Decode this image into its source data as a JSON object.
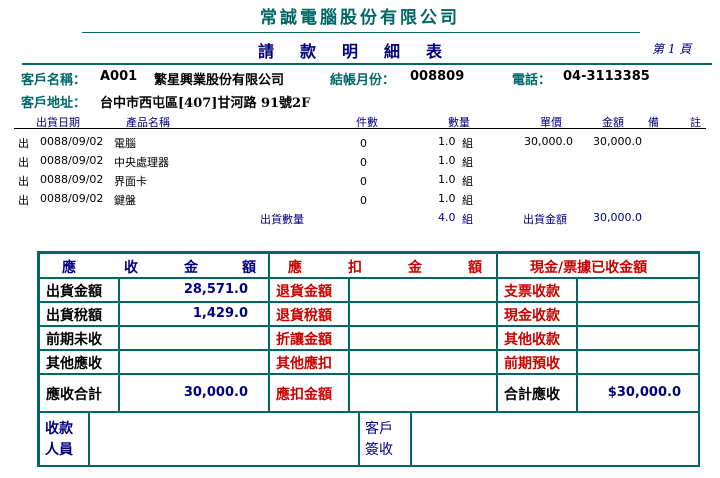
{
  "header": {
    "company": "常誠電腦股份有限公司",
    "doc_title": "請款明細表",
    "page": "第 1 頁"
  },
  "customer": {
    "name_label": "客戶名稱：",
    "code": "A001",
    "name": "繁星興業股份有限公司",
    "period_label": "結帳月份：",
    "period": "008809",
    "phone_label": "電話：",
    "phone": "04-3113385",
    "addr_label": "客戶地址：",
    "address": "台中市西屯區[407]甘河路 91號2F"
  },
  "columns": {
    "date": "出貨日期",
    "product": "產品名稱",
    "pieces": "件數",
    "qty": "數量",
    "price": "單價",
    "amount": "金額",
    "remark1": "備",
    "remark2": "註"
  },
  "rows": [
    {
      "type": "出",
      "date": "0088/09/02",
      "product": "電腦",
      "pieces": "0",
      "qty": "1.0",
      "unit": "組",
      "price": "30,000.0",
      "amount": "30,000.0"
    },
    {
      "type": "出",
      "date": "0088/09/02",
      "product": "中央處理器",
      "pieces": "0",
      "qty": "1.0",
      "unit": "組",
      "price": "",
      "amount": ""
    },
    {
      "type": "出",
      "date": "0088/09/02",
      "product": "界面卡",
      "pieces": "0",
      "qty": "1.0",
      "unit": "組",
      "price": "",
      "amount": ""
    },
    {
      "type": "出",
      "date": "0088/09/02",
      "product": "鍵盤",
      "pieces": "0",
      "qty": "1.0",
      "unit": "組",
      "price": "",
      "amount": ""
    }
  ],
  "totals": {
    "qty_label": "出貨數量",
    "qty": "4.0",
    "unit": "組",
    "amount_label": "出貨金額",
    "amount": "30,000.0"
  },
  "summary": {
    "receivable_header": [
      "應",
      "收",
      "金",
      "額"
    ],
    "deduction_header": [
      "應",
      "扣",
      "金",
      "額"
    ],
    "received_header": "現金/票據已收金額",
    "receivable": [
      {
        "label": "出貨金額",
        "value": "28,571.0"
      },
      {
        "label": "出貨稅額",
        "value": "1,429.0"
      },
      {
        "label": "前期未收",
        "value": ""
      },
      {
        "label": "其他應收",
        "value": ""
      },
      {
        "label": "應收合計",
        "value": "30,000.0"
      }
    ],
    "deduction": [
      {
        "label": "退貨金額"
      },
      {
        "label": "退貨稅額"
      },
      {
        "label": "折讓金額"
      },
      {
        "label": "其他應扣"
      },
      {
        "label": "應扣金額"
      }
    ],
    "received": [
      {
        "label": "支票收款",
        "value": ""
      },
      {
        "label": "現金收款",
        "value": ""
      },
      {
        "label": "其他收款",
        "value": ""
      },
      {
        "label": "前期預收",
        "value": ""
      },
      {
        "label": "合計應收",
        "value": "$30,000.0"
      }
    ],
    "collector_line1": "收款",
    "collector_line2": "人員",
    "signer_line1": "客戶",
    "signer_line2": "簽收"
  }
}
